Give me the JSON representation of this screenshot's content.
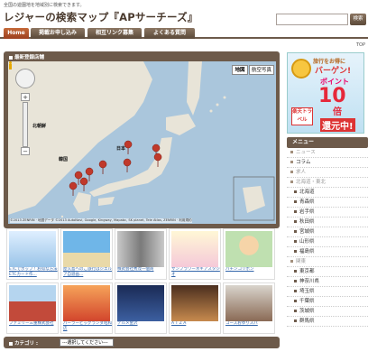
{
  "header": {
    "tagline": "全国の遊園地を地域別に検索できます。",
    "title": "レジャーの検索マップ『APサーチーズ』",
    "search_button": "検索"
  },
  "nav": {
    "items": [
      "Home",
      "掲載お申し込み",
      "相互リンク募集",
      "よくある質問"
    ],
    "active": "Home",
    "top_link": "TOP"
  },
  "map_panel": {
    "title": "最新登録店舗",
    "map_button": "地図",
    "satellite_button": "航空写真",
    "labels": {
      "hokkaido": "北朝鮮",
      "korea": "韓国",
      "japan": "日本"
    },
    "copyright": "©2013 ZENRIN · 地図データ ©2013 AutoNavi, Google, Kingway, Mapabc, SK planet, Tele Atlas, ZENRIN · 利用規約"
  },
  "thumbnails": [
    {
      "caption": "ETCでポップ ! お得な方法ETCカード作..."
    },
    {
      "caption": "屋久島へのご旅行はジエルア自遊画..."
    },
    {
      "caption": "株式会社秀茂一個商"
    },
    {
      "caption": "サンフラワーネギアスタジオ"
    },
    {
      "caption": "パチンコリポン"
    },
    {
      "caption": "ファミリー三重株式会社"
    },
    {
      "caption": "パーラービッグランダ昭和店"
    },
    {
      "caption": "テルメ金沢"
    },
    {
      "caption": "A T Z A"
    },
    {
      "caption": "コーズおゆりスパ"
    }
  ],
  "category": {
    "label": "カテゴリ :",
    "select_value": "---選択してください---"
  },
  "banner": {
    "line1": "旅行をお得に",
    "line2": "バーゲン!",
    "line3": "ポイント",
    "line4": "10",
    "line5": "倍",
    "line6": "還元中!",
    "store": "楽天トラベル"
  },
  "menu": {
    "title": "メニュー",
    "items": [
      {
        "label": "ニュース",
        "type": "head"
      },
      {
        "label": "コラム",
        "type": "item"
      },
      {
        "label": "求人",
        "type": "head"
      },
      {
        "label": "北海道・東北",
        "type": "head"
      },
      {
        "label": "北海道",
        "type": "sub"
      },
      {
        "label": "青森県",
        "type": "sub"
      },
      {
        "label": "岩手県",
        "type": "sub"
      },
      {
        "label": "秋田県",
        "type": "sub"
      },
      {
        "label": "宮城県",
        "type": "sub"
      },
      {
        "label": "山形県",
        "type": "sub"
      },
      {
        "label": "福島県",
        "type": "sub"
      },
      {
        "label": "関東",
        "type": "head"
      },
      {
        "label": "東京都",
        "type": "sub"
      },
      {
        "label": "神奈川県",
        "type": "sub"
      },
      {
        "label": "埼玉県",
        "type": "sub"
      },
      {
        "label": "千葉県",
        "type": "sub"
      },
      {
        "label": "茨城県",
        "type": "sub"
      },
      {
        "label": "群馬県",
        "type": "sub"
      }
    ]
  },
  "colors": {
    "brand_brown": "#6d5a4a",
    "active_tab": "#b5522b",
    "link": "#3366aa"
  }
}
